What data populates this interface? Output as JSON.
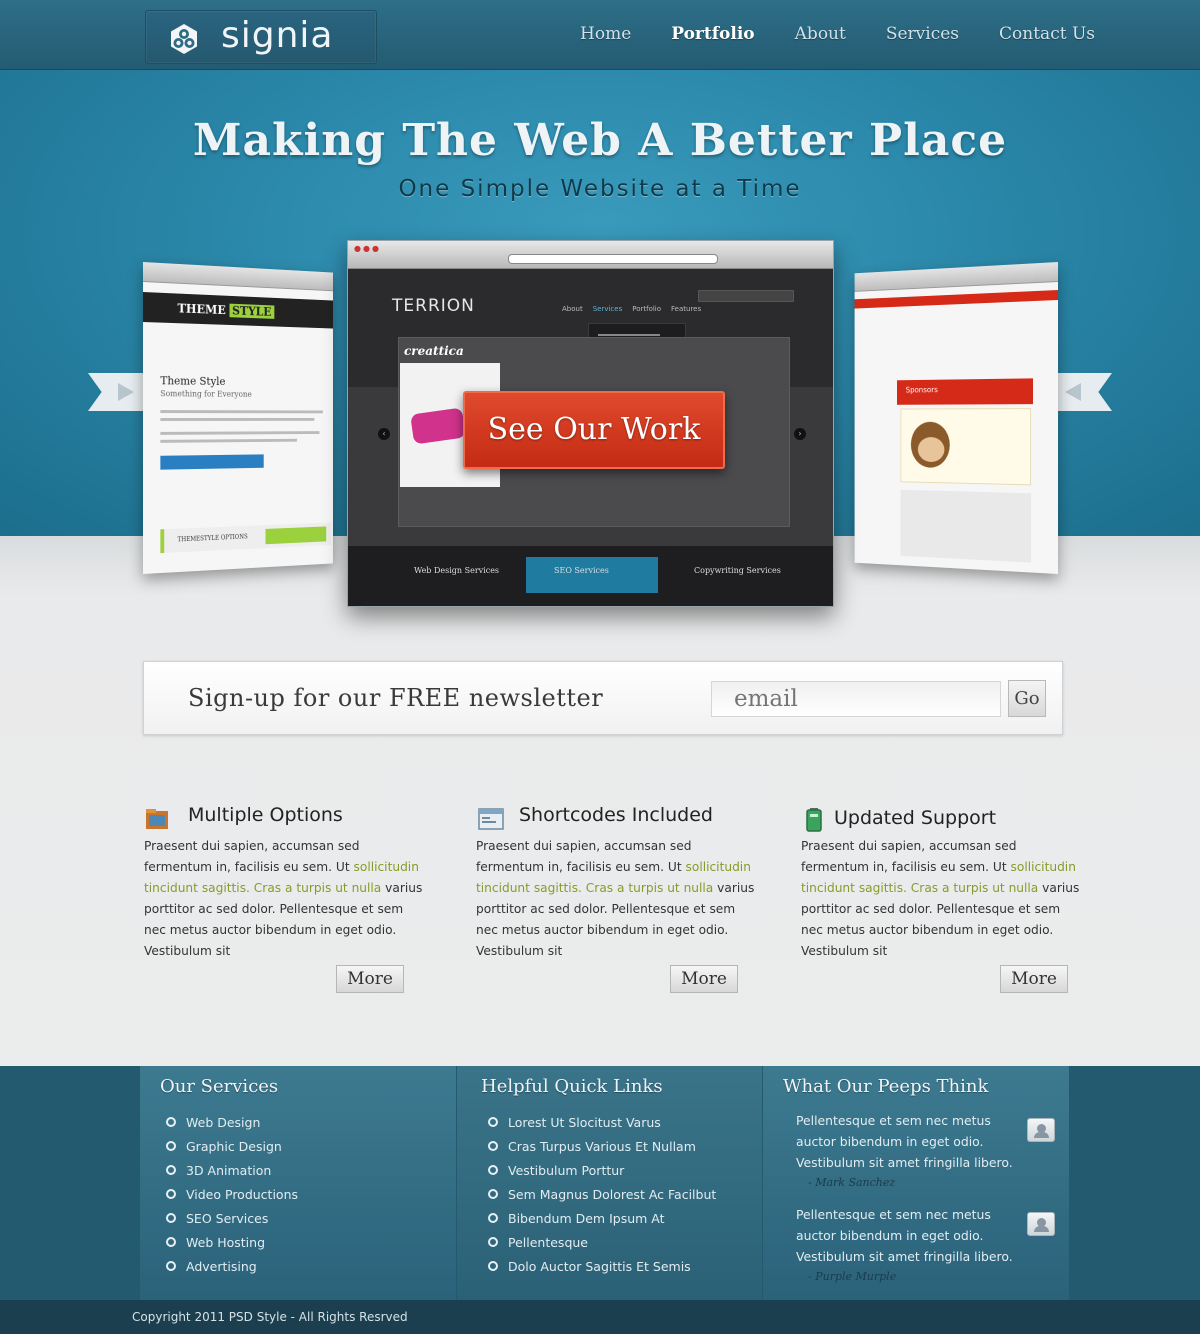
{
  "header": {
    "logo": "signia",
    "nav": [
      "Home",
      "Portfolio",
      "About",
      "Services",
      "Contact Us"
    ],
    "active_nav": "Portfolio"
  },
  "hero": {
    "title": "Making The Web A Better Place",
    "subtitle": "One Simple Website at a Time",
    "cta": "See Our Work",
    "slides": {
      "left": {
        "logo_a": "THEME",
        "logo_b": "STYLE",
        "heading_1": "Theme Style",
        "heading_2": "Something for Everyone",
        "footer_label": "THEMESTYLE OPTIONS"
      },
      "center": {
        "logo": "TERRION",
        "nav": [
          "About",
          "Services",
          "Portfolio",
          "Features"
        ],
        "slide_title": "creattica",
        "tiles": [
          "Web Design Services",
          "SEO Services",
          "Copywriting Services"
        ]
      },
      "right": {
        "banner": "Sponsors"
      }
    }
  },
  "newsletter": {
    "label": "Sign-up for our FREE newsletter",
    "placeholder": "email",
    "button": "Go"
  },
  "features": [
    {
      "title": "Multiple Options",
      "icon": "folder-icon",
      "text_before": "Praesent dui sapien, accumsan sed fermentum in, facilisis eu sem. Ut ",
      "link": "sollicitudin tincidunt sagittis. Cras a turpis ut nulla",
      "text_after": " varius porttitor ac sed dolor. Pellentesque et sem nec metus auctor bibendum in eget odio. Vestibulum sit",
      "button": "More"
    },
    {
      "title": "Shortcodes Included",
      "icon": "browser-window-icon",
      "text_before": "Praesent dui sapien, accumsan sed fermentum in, facilisis eu sem. Ut ",
      "link": "sollicitudin tincidunt sagittis. Cras a turpis ut nulla",
      "text_after": " varius porttitor ac sed dolor. Pellentesque et sem nec metus auctor bibendum in eget odio. Vestibulum sit",
      "button": "More"
    },
    {
      "title": "Updated Support",
      "icon": "battery-icon",
      "text_before": "Praesent dui sapien, accumsan sed fermentum in, facilisis eu sem. Ut ",
      "link": "sollicitudin tincidunt sagittis. Cras a turpis ut nulla",
      "text_after": " varius porttitor ac sed dolor. Pellentesque et sem nec metus auctor bibendum in eget odio. Vestibulum sit",
      "button": "More"
    }
  ],
  "footer": {
    "services": {
      "title": "Our Services",
      "items": [
        "Web Design",
        "Graphic Design",
        "3D Animation",
        "Video Productions",
        "SEO Services",
        "Web Hosting",
        "Advertising"
      ]
    },
    "quick_links": {
      "title": "Helpful Quick Links",
      "items": [
        "Lorest Ut Slocitust Varus",
        "Cras Turpus Various Et Nullam",
        "Vestibulum Porttur",
        "Sem Magnus Dolorest Ac Facilbut",
        "Bibendum Dem Ipsum At",
        "Pellentesque",
        "Dolo Auctor Sagittis Et Semis"
      ]
    },
    "testimonials": {
      "title": "What Our Peeps Think",
      "items": [
        {
          "text": "Pellentesque et sem nec metus auctor bibendum in eget odio. Vestibulum sit amet fringilla libero.",
          "author": "- Mark Sanchez"
        },
        {
          "text": "Pellentesque et sem nec metus auctor bibendum in eget odio. Vestibulum sit amet fringilla libero.",
          "author": "- Purple Murple"
        }
      ]
    },
    "copyright": "Copyright 2011 PSD Style - All Rights Resrved"
  },
  "colors": {
    "header": "#245b72",
    "hero": "#2a87a9",
    "cta": "#c42b14",
    "footer": "#2a627a",
    "link": "#8a9a2a"
  }
}
